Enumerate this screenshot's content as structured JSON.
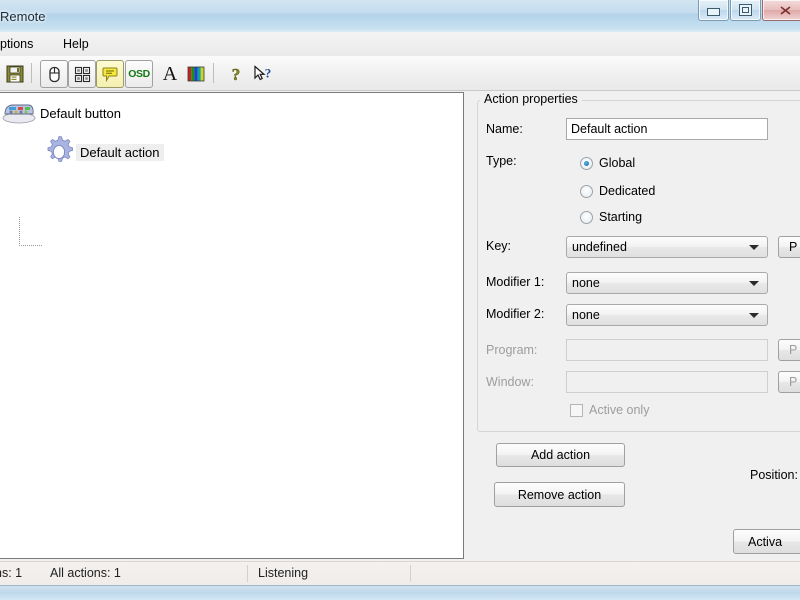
{
  "window": {
    "title": "Remote",
    "controls": [
      {
        "name": "minimize",
        "glyph": "minimize-icon"
      },
      {
        "name": "maximize",
        "glyph": "maximize-icon"
      },
      {
        "name": "close",
        "glyph": "close-icon"
      }
    ]
  },
  "menubar": {
    "items": [
      {
        "label": "ptions",
        "name": "menu-options"
      },
      {
        "label": "Help",
        "name": "menu-help"
      }
    ]
  },
  "toolbar": {
    "items": [
      {
        "name": "save-icon",
        "label": "Save",
        "style": "plain"
      },
      {
        "name": "remote-device-icon",
        "label": "Remote device",
        "style": "framed"
      },
      {
        "name": "keypad-grid-icon",
        "label": "Button grid",
        "style": "framed"
      },
      {
        "name": "balloon-tip-icon",
        "label": "Balloon tips",
        "style": "pressed"
      },
      {
        "name": "osd-icon",
        "label": "OSD",
        "style": "framed"
      },
      {
        "name": "font-icon",
        "label": "Font",
        "style": "plain"
      },
      {
        "name": "colors-icon",
        "label": "Colors",
        "style": "plain"
      },
      {
        "name": "help-icon",
        "label": "Help",
        "style": "plain"
      },
      {
        "name": "context-help-icon",
        "label": "What's this",
        "style": "plain"
      }
    ],
    "osd_text": "OSD",
    "font_glyph": "A"
  },
  "tree": {
    "nodes": [
      {
        "label": "Default button",
        "icon": "remote-control-icon",
        "selected": false
      },
      {
        "label": "Default action",
        "icon": "gear-icon",
        "selected": true
      }
    ]
  },
  "properties": {
    "group_title": "Action properties",
    "name_label": "Name:",
    "name_value": "Default action",
    "type_label": "Type:",
    "type_options": [
      {
        "label": "Global",
        "checked": true
      },
      {
        "label": "Dedicated",
        "checked": false
      },
      {
        "label": "Starting",
        "checked": false
      }
    ],
    "key_label": "Key:",
    "key_value": "undefined",
    "key_button": "P",
    "modifier1_label": "Modifier 1:",
    "modifier1_value": "none",
    "modifier2_label": "Modifier 2:",
    "modifier2_value": "none",
    "program_label": "Program:",
    "program_value": "",
    "program_button": "P",
    "window_label": "Window:",
    "window_value": "",
    "window_button": "P",
    "active_only_label": "Active only",
    "active_only_checked": false
  },
  "actions": {
    "add_label": "Add action",
    "remove_label": "Remove action",
    "position_label": "Position:",
    "activate_label": "Activa"
  },
  "statusbar": {
    "cells": [
      {
        "text": "ns: 1",
        "name": "status-buttons-count"
      },
      {
        "text": "All actions: 1",
        "name": "status-all-actions"
      },
      {
        "text": "Listening",
        "name": "status-listening"
      }
    ]
  },
  "colors": {
    "title_bar": "#c3dcee",
    "accent_blue": "#1f7bb5",
    "gear_blue": "#a9b5e0",
    "osd_green": "#1a7a1a",
    "selection_grey": "#eeeeee"
  }
}
